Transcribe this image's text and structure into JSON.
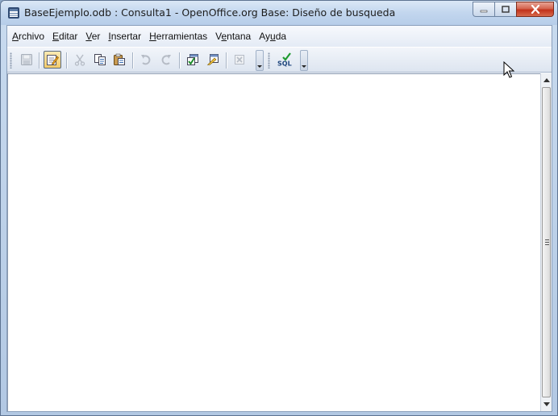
{
  "window": {
    "title": "BaseEjemplo.odb : Consulta1 - OpenOffice.org Base: Diseño de busqueda"
  },
  "menubar": {
    "items": [
      {
        "label": "Archivo",
        "mnemonic": "A",
        "rest": "rchivo"
      },
      {
        "label": "Editar",
        "mnemonic": "E",
        "rest": "ditar"
      },
      {
        "label": "Ver",
        "mnemonic": "V",
        "rest": "er"
      },
      {
        "label": "Insertar",
        "mnemonic": "I",
        "rest": "nsertar"
      },
      {
        "label": "Herramientas",
        "mnemonic": "H",
        "rest": "erramientas"
      },
      {
        "label": "Ventana",
        "pre": "V",
        "mnemonic": "e",
        "rest": "ntana"
      },
      {
        "label": "Ayuda",
        "pre": "Ay",
        "mnemonic": "u",
        "rest": "da"
      }
    ]
  },
  "toolbar": {
    "buttons": [
      {
        "icon": "save-icon",
        "enabled": false
      },
      {
        "icon": "edit-mode-icon",
        "enabled": true,
        "active": true
      },
      {
        "icon": "cut-icon",
        "enabled": false
      },
      {
        "icon": "copy-icon",
        "enabled": true
      },
      {
        "icon": "paste-icon",
        "enabled": true
      },
      {
        "icon": "undo-icon",
        "enabled": false
      },
      {
        "icon": "redo-icon",
        "enabled": false
      },
      {
        "icon": "run-query-icon",
        "enabled": true
      },
      {
        "icon": "clear-query-icon",
        "enabled": true
      },
      {
        "icon": "delete-table-icon",
        "enabled": false
      },
      {
        "icon": "sql-icon",
        "enabled": true
      }
    ],
    "sql_label": "SQL"
  },
  "colors": {
    "accent": "#f2cb6b",
    "close_button": "#c2311a"
  }
}
